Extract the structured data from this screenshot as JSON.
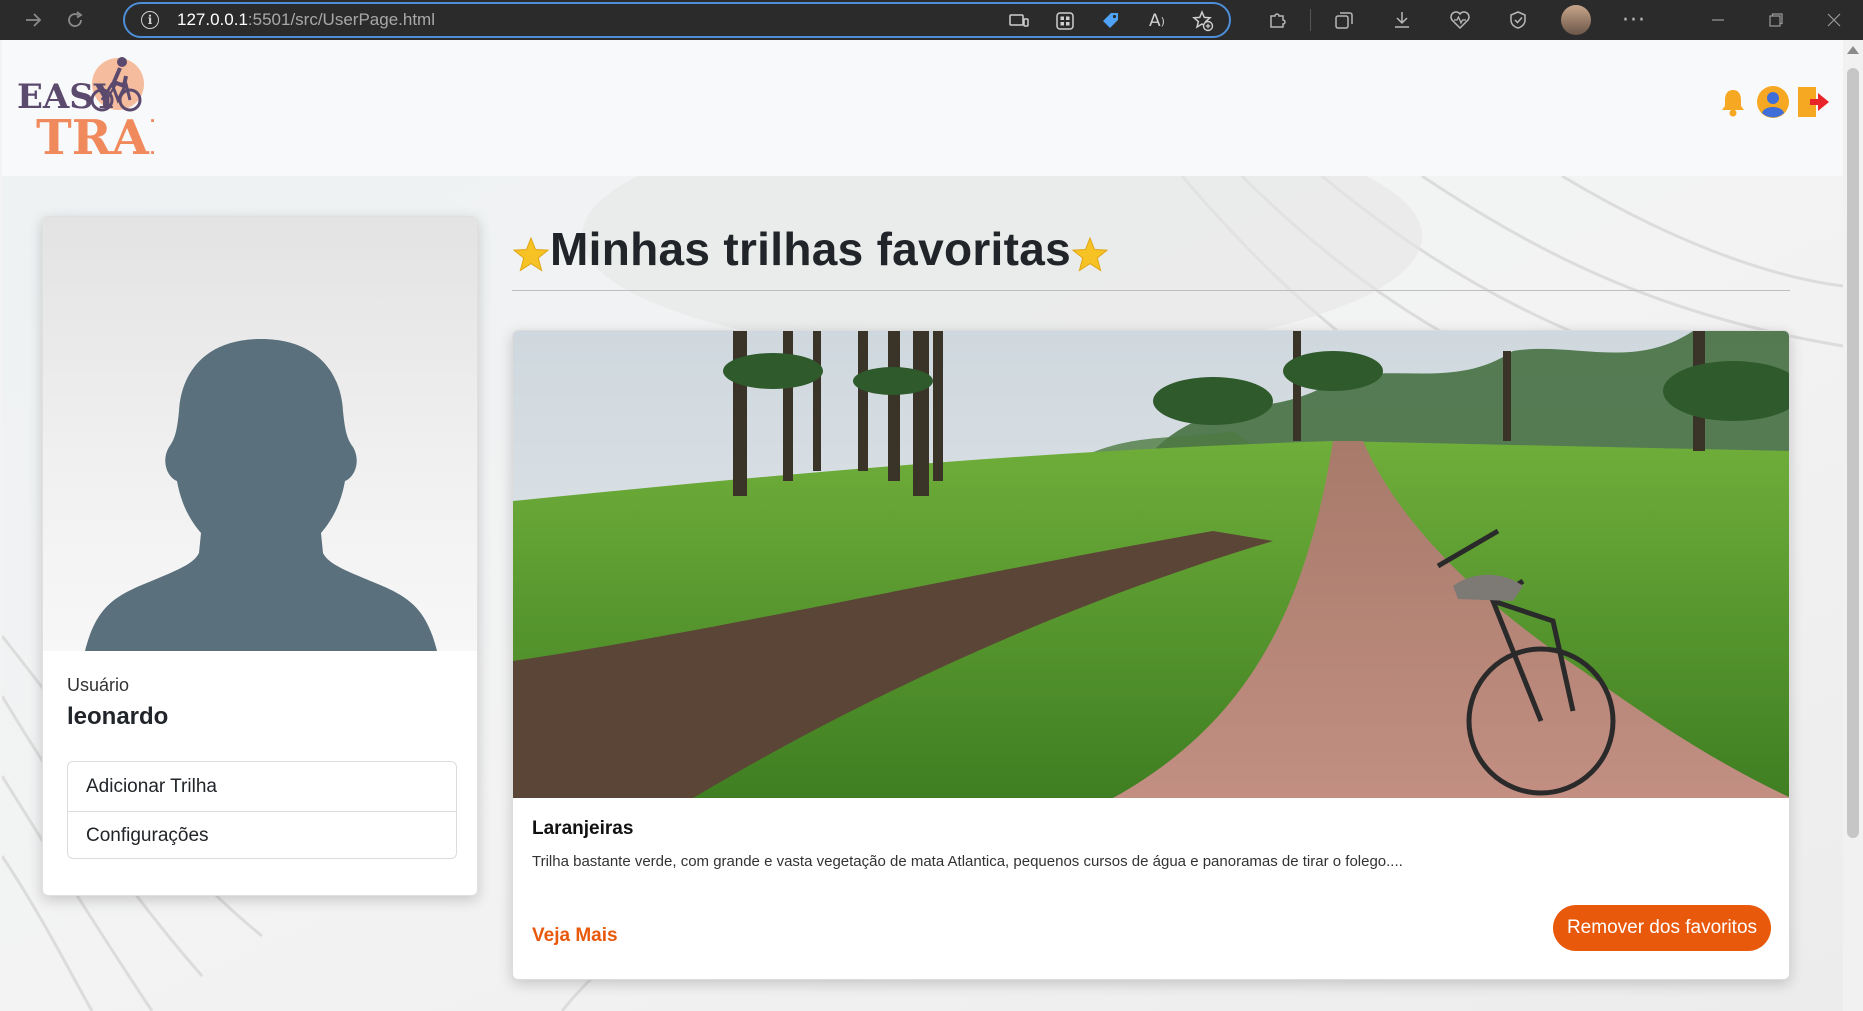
{
  "browser": {
    "url_host": "127.0.0.1",
    "url_path": ":5501/src/UserPage.html"
  },
  "header": {
    "logo_line1": "EASY",
    "logo_line2": "TRAIL",
    "icons": [
      "bell-icon",
      "user-avatar-icon",
      "logout-icon"
    ]
  },
  "profile": {
    "user_label": "Usuário",
    "user_name": "leonardo",
    "menu": [
      {
        "label": "Adicionar Trilha"
      },
      {
        "label": "Configurações"
      }
    ]
  },
  "favorites": {
    "title": "Minhas trilhas favoritas",
    "trail": {
      "name": "Laranjeiras",
      "description": "Trilha bastante verde, com grande e vasta vegetação de mata Atlantica, pequenos cursos de água e panoramas de tirar o folego....",
      "see_more": "Veja Mais",
      "remove_button": "Remover dos favoritos"
    }
  },
  "colors": {
    "accent": "#e8590c",
    "logo_purple": "#5b4a6e",
    "logo_orange": "#f08a5d",
    "avatar_silhouette": "#5a707c"
  }
}
